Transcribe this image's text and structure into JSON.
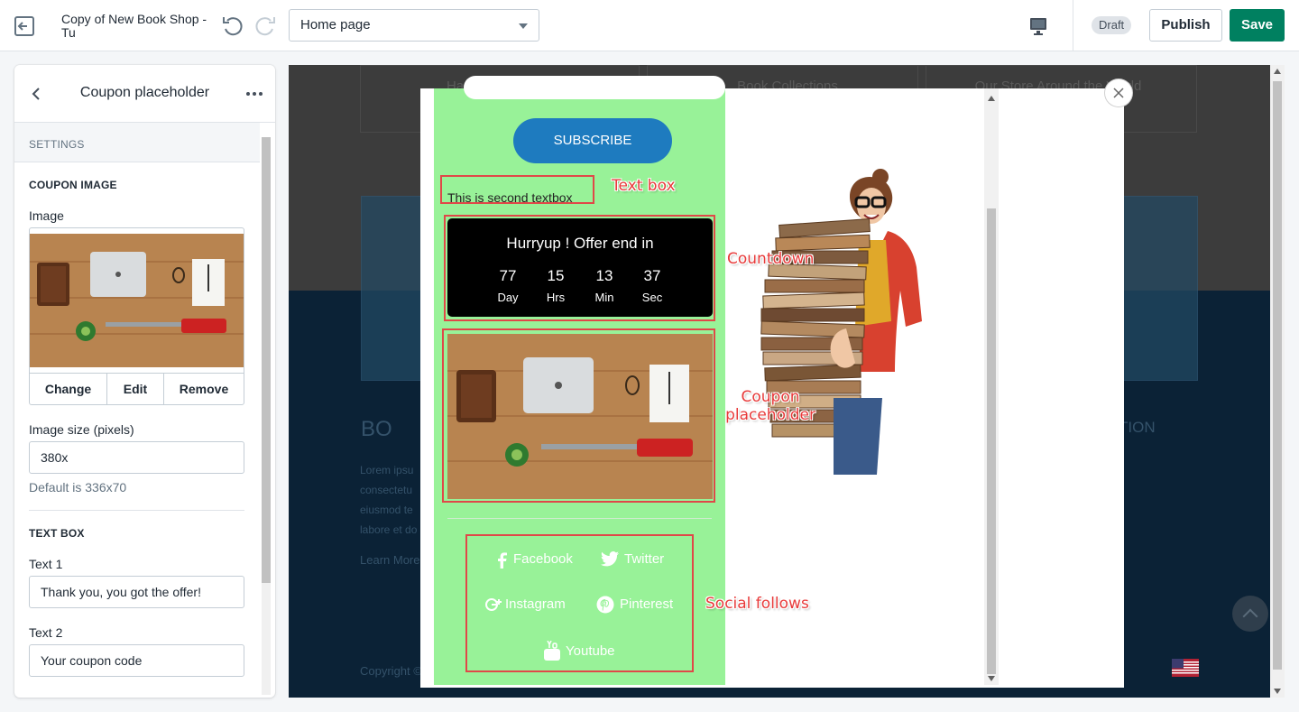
{
  "topbar": {
    "shop_title": "Copy of New Book Shop - Tu",
    "page_select": "Home page",
    "status": "Draft",
    "publish_label": "Publish",
    "save_label": "Save"
  },
  "sidebar": {
    "title": "Coupon placeholder",
    "settings_label": "SETTINGS",
    "coupon_image": {
      "section_title": "COUPON IMAGE",
      "image_label": "Image",
      "change_label": "Change",
      "edit_label": "Edit",
      "remove_label": "Remove",
      "size_label": "Image size (pixels)",
      "size_value": "380x",
      "size_help": "Default is 336x70"
    },
    "text_box": {
      "section_title": "TEXT BOX",
      "text1_label": "Text 1",
      "text1_value": "Thank you, you got the offer!",
      "text2_label": "Text 2",
      "text2_value": "Your coupon code"
    }
  },
  "preview": {
    "cards": [
      "Happy Customers",
      "Book Collections",
      "Our Store Around the World"
    ],
    "heading_left": "BO",
    "heading_right": "TION",
    "lorem": "Lorem ipsu consectetu eiusmod te labore et do",
    "learn_more": "Learn More",
    "copyright": "Copyright ©"
  },
  "popup": {
    "subscribe_label": "SUBSCRIBE",
    "second_textbox": "This is second textbox",
    "countdown": {
      "title": "Hurryup ! Offer end in",
      "values": [
        "77",
        "15",
        "13",
        "37"
      ],
      "units": [
        "Day",
        "Hrs",
        "Min",
        "Sec"
      ]
    },
    "social": {
      "facebook": "Facebook",
      "twitter": "Twitter",
      "instagram": "Instagram",
      "pinterest": "Pinterest",
      "youtube": "Youtube"
    }
  },
  "annotations": {
    "text_box": "Text box",
    "countdown": "Countdown",
    "coupon_line1": "Coupon",
    "coupon_line2": "placeholder",
    "social": "Social follows"
  },
  "colors": {
    "save_green": "#008060",
    "popup_green": "#98f298",
    "subscribe_blue": "#1e7bbf",
    "annotation_red": "#e04848"
  }
}
